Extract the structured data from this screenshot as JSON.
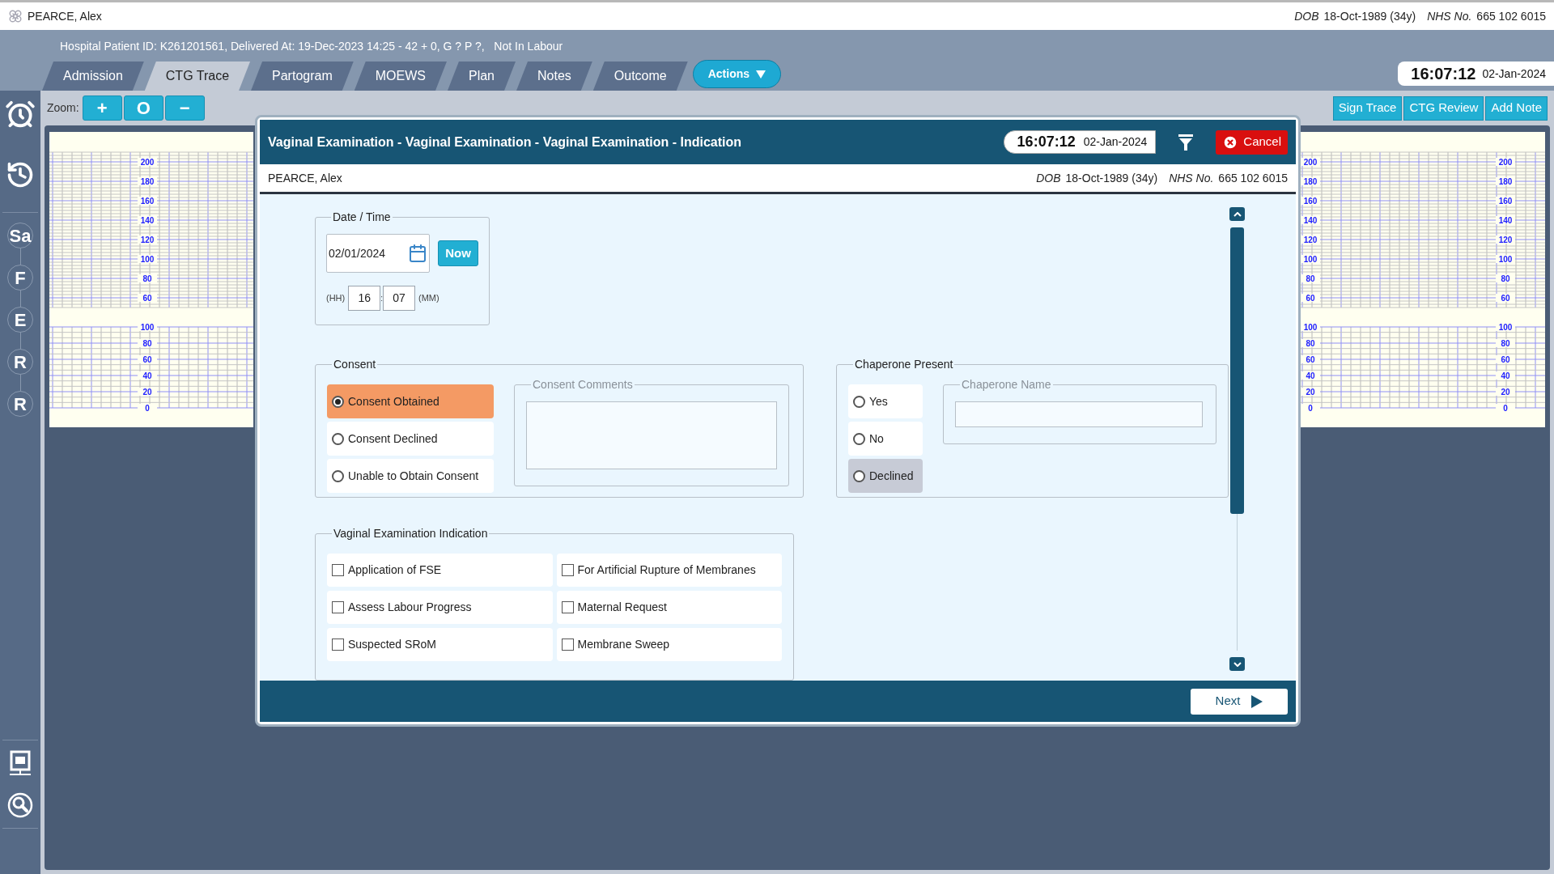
{
  "patient_bar": {
    "name": "PEARCE, Alex",
    "dob_label": "DOB",
    "dob": "18-Oct-1989 (34y)",
    "nhs_label": "NHS No.",
    "nhs": "665 102 6015"
  },
  "episode_info": "Hospital Patient ID: K261201561, Delivered At: 19-Dec-2023 14:25 - 42 + 0, G ? P ?,   Not In Labour",
  "tabs": [
    {
      "label": "Admission",
      "selected": false
    },
    {
      "label": "CTG Trace",
      "selected": true
    },
    {
      "label": "Partogram",
      "selected": false
    },
    {
      "label": "MOEWS",
      "selected": false
    },
    {
      "label": "Plan",
      "selected": false
    },
    {
      "label": "Notes",
      "selected": false
    },
    {
      "label": "Outcome",
      "selected": false
    }
  ],
  "actions_button": "Actions",
  "clock": {
    "time": "16:07:12",
    "date": "02-Jan-2024"
  },
  "sidebar": {
    "markers": [
      "Sa",
      "F",
      "E",
      "R",
      "R"
    ]
  },
  "toolbar": {
    "zoom_label": "Zoom:",
    "zoom_buttons": [
      "+",
      "O",
      "−"
    ],
    "buttons": [
      "Sign Trace",
      "CTG Review",
      "Add Note"
    ]
  },
  "ctg_panels": [
    {
      "axes": [
        {
          "fhr": [
            "200",
            "180",
            "160",
            "140",
            "120",
            "100",
            "80",
            "60"
          ],
          "toco": [
            "100",
            "80",
            "60",
            "40",
            "20",
            "0"
          ]
        }
      ]
    },
    {
      "axes": [
        {
          "fhr": [
            "200",
            "180",
            "160",
            "140",
            "120",
            "100",
            "80",
            "60"
          ],
          "toco": [
            "100",
            "80",
            "60",
            "40",
            "20",
            "0"
          ]
        },
        {
          "fhr": [
            "200",
            "180",
            "160",
            "140",
            "120",
            "100",
            "80",
            "60"
          ],
          "toco": [
            "100",
            "80",
            "60",
            "40",
            "20",
            "0"
          ]
        }
      ]
    }
  ],
  "dialog": {
    "title": "Vaginal Examination - Vaginal Examination - Vaginal Examination - Indication",
    "clock": {
      "time": "16:07:12",
      "date": "02-Jan-2024"
    },
    "cancel": "Cancel",
    "patient": {
      "name": "PEARCE, Alex",
      "dob_label": "DOB",
      "dob": "18-Oct-1989 (34y)",
      "nhs_label": "NHS No.",
      "nhs": "665 102 6015"
    },
    "date_time": {
      "legend": "Date / Time",
      "date": "02/01/2024",
      "now": "Now",
      "hh_label": "(HH)",
      "hour": "16",
      "separator": ":",
      "minute": "07",
      "mm_label": "(MM)"
    },
    "consent": {
      "legend": "Consent",
      "options": [
        {
          "label": "Consent Obtained",
          "selected": true
        },
        {
          "label": "Consent Declined",
          "selected": false
        },
        {
          "label": "Unable to Obtain Consent",
          "selected": false
        }
      ],
      "comments_legend": "Consent Comments"
    },
    "chaperone": {
      "legend": "Chaperone Present",
      "options": [
        {
          "label": "Yes",
          "selected": false,
          "highlighted": false
        },
        {
          "label": "No",
          "selected": false,
          "highlighted": false
        },
        {
          "label": "Declined",
          "selected": false,
          "highlighted": true
        }
      ],
      "name_legend": "Chaperone Name"
    },
    "indication": {
      "legend": "Vaginal Examination Indication",
      "items": [
        {
          "label": "Application of FSE",
          "checked": false
        },
        {
          "label": "For Artificial Rupture of Membranes",
          "checked": false
        },
        {
          "label": "Assess Labour Progress",
          "checked": false
        },
        {
          "label": "Maternal Request",
          "checked": false
        },
        {
          "label": "Suspected SRoM",
          "checked": false
        },
        {
          "label": "Membrane Sweep",
          "checked": false
        }
      ]
    },
    "next": "Next"
  }
}
